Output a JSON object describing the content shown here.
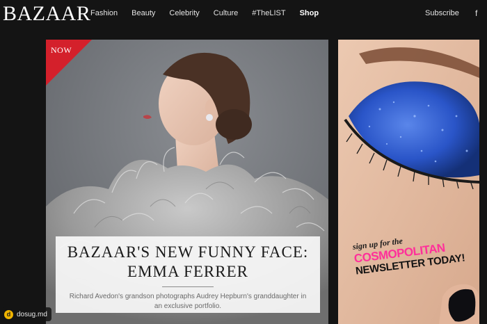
{
  "header": {
    "logo": "BAZAAR",
    "nav": [
      {
        "label": "Fashion"
      },
      {
        "label": "Beauty"
      },
      {
        "label": "Celebrity"
      },
      {
        "label": "Culture"
      },
      {
        "label": "#TheLIST"
      },
      {
        "label": "Shop"
      }
    ],
    "subscribe": "Subscribe",
    "facebook": "f"
  },
  "hero": {
    "badge": "NOW",
    "headline_line1": "BAZAAR'S NEW FUNNY FACE:",
    "headline_line2": "EMMA FERRER",
    "dek": "Richard Avedon's grandson photographs Audrey Hepburn's granddaughter in an exclusive portfolio."
  },
  "ad": {
    "line1": "sign up for the",
    "brand": "COSMOPOLITAN",
    "line3": "NEWSLETTER TODAY!"
  },
  "watermark": {
    "text": "dosug.md"
  },
  "colors": {
    "badge_red": "#d4202b",
    "cosmo_pink": "#ff2f9a",
    "eyeshadow_blue": "#2a55c8"
  }
}
